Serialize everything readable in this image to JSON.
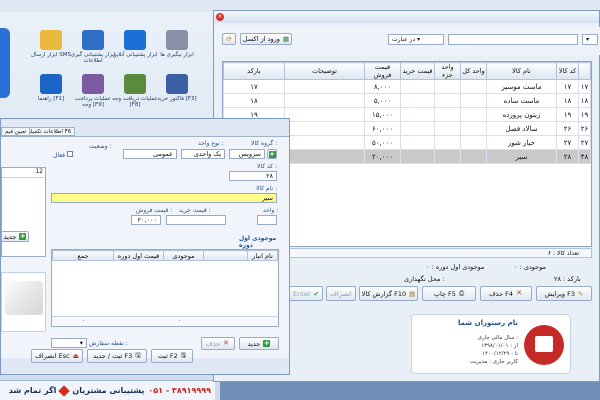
{
  "desktop": {
    "icons": [
      {
        "label": "ابزار ارسال SMS",
        "color": "#e9b83c"
      },
      {
        "label": "ابزار پشتیبانی گیری اطلاعات",
        "color": "#2f6fc8"
      },
      {
        "label": "ابزار پشتیبانی آنلاین",
        "color": "#1d6fd6"
      },
      {
        "label": "ابزار بیگیری ها",
        "color": "#8a8fa8"
      },
      {
        "label": "راهنما [F1]",
        "color": "#1c65c7"
      },
      {
        "label": "عملیات پرداخت وجه [F9]",
        "color": "#7c5aa0"
      },
      {
        "label": "عملیات دریافت وجه [F8]",
        "color": "#5a8a3c"
      },
      {
        "label": "فاکتور خرید [F3]",
        "color": "#3c5fa6"
      }
    ],
    "support_label": "پشتیبانی مشتریان",
    "support_phone": "۰۵۱ - ۳۸۹۱۹۹۹۹",
    "status_text": "اگر تمام شد"
  },
  "right_window": {
    "toolbar": {
      "excel_button": "ورود از اکسل",
      "search_field_label": "در عبارت"
    },
    "table": {
      "headers": [
        "کد کالا",
        "نام کالا",
        "واحد کل",
        "واحد جزء",
        "قیمت خرید",
        "قیمت فروش",
        "توضیحات",
        "بارکد"
      ],
      "rows": [
        {
          "idx": "۱۷",
          "code": "۱۷",
          "name": "ماست موسیر",
          "sell": "۸,۰۰۰",
          "barcode": "۱۷"
        },
        {
          "idx": "۱۸",
          "code": "۱۸",
          "name": "ماست ساده",
          "sell": "۵,۰۰۰",
          "barcode": "۱۸"
        },
        {
          "idx": "۱۹",
          "code": "۱۹",
          "name": "زیتون پرورده",
          "sell": "۱۵,۰۰۰",
          "barcode": "۱۹"
        },
        {
          "idx": "۲۶",
          "code": "۲۶",
          "name": "سالاد فصل",
          "sell": "۶۰,۰۰۰",
          "barcode": ""
        },
        {
          "idx": "۲۷",
          "code": "۲۷",
          "name": "خیار شور",
          "sell": "۵۰,۰۰۰",
          "barcode": ""
        },
        {
          "idx": "۴۸",
          "code": "۲۸",
          "name": "سیر",
          "sell": "۲۰,۰۰۰",
          "barcode": ""
        }
      ],
      "footer": "تعداد کالا : ۶"
    },
    "info": {
      "stock_period": "موجودی اول دوره : ۰",
      "barcode": "بارکد : ۲۸",
      "location": "محل نگهداری :",
      "stock": "موجودی : ۰"
    },
    "buttons": {
      "edit": "ویرایش F3",
      "delete": "حذف F4",
      "print": "چاپ F5",
      "report": "گزارش کالا F10",
      "cancel": "انصراف",
      "enter": "Enter"
    },
    "restaurant_card": {
      "name": "نام رستوران شما",
      "line1": "سال مالی جاری :",
      "line2": "از : ۱۳۹۸/۰۱/۰۱",
      "line3": "تا : ۱۴۰۰/۱۲/۲۹",
      "line4": "کاربر جاری : مدیریت"
    }
  },
  "left_window": {
    "tabs": [
      "اطلاعات تکمیلی F6",
      "تعیین قیم"
    ],
    "form": {
      "group_label": "گروه کالا :",
      "group_value": "سرویس",
      "unit_label": "نوع واحد :",
      "unit_value": "یک واحدی",
      "sub_unit_value": "عمومی",
      "status_label": "وضعیت :",
      "active_label": "فعال",
      "code_label": "کد کالا :",
      "code_value": "۲۸",
      "name_label": "نام کالا :",
      "name_value": "سیر",
      "unit2_label": "واحد :",
      "buy_price_label": "قیمت خرید :",
      "sell_price_label": "قیمت فروش :",
      "sell_price_value": "۲۰,۰۰۰",
      "left_field": "12"
    },
    "stock_section": {
      "title": "موجودی اول دوره",
      "headers": [
        "نام انبار",
        "موجودی",
        "قیمت اول دوره",
        "جمع"
      ],
      "total_1": "۰",
      "total_2": "۰",
      "reorder_label": "نقطه سفارش :",
      "new_button": "جدید",
      "delete_button": "حذف",
      "left_new": "جدید"
    },
    "bottom_buttons": {
      "save": "ثبت F2",
      "save_new": "ثبت / جدید F3",
      "cancel": "انصراف Esc"
    }
  }
}
